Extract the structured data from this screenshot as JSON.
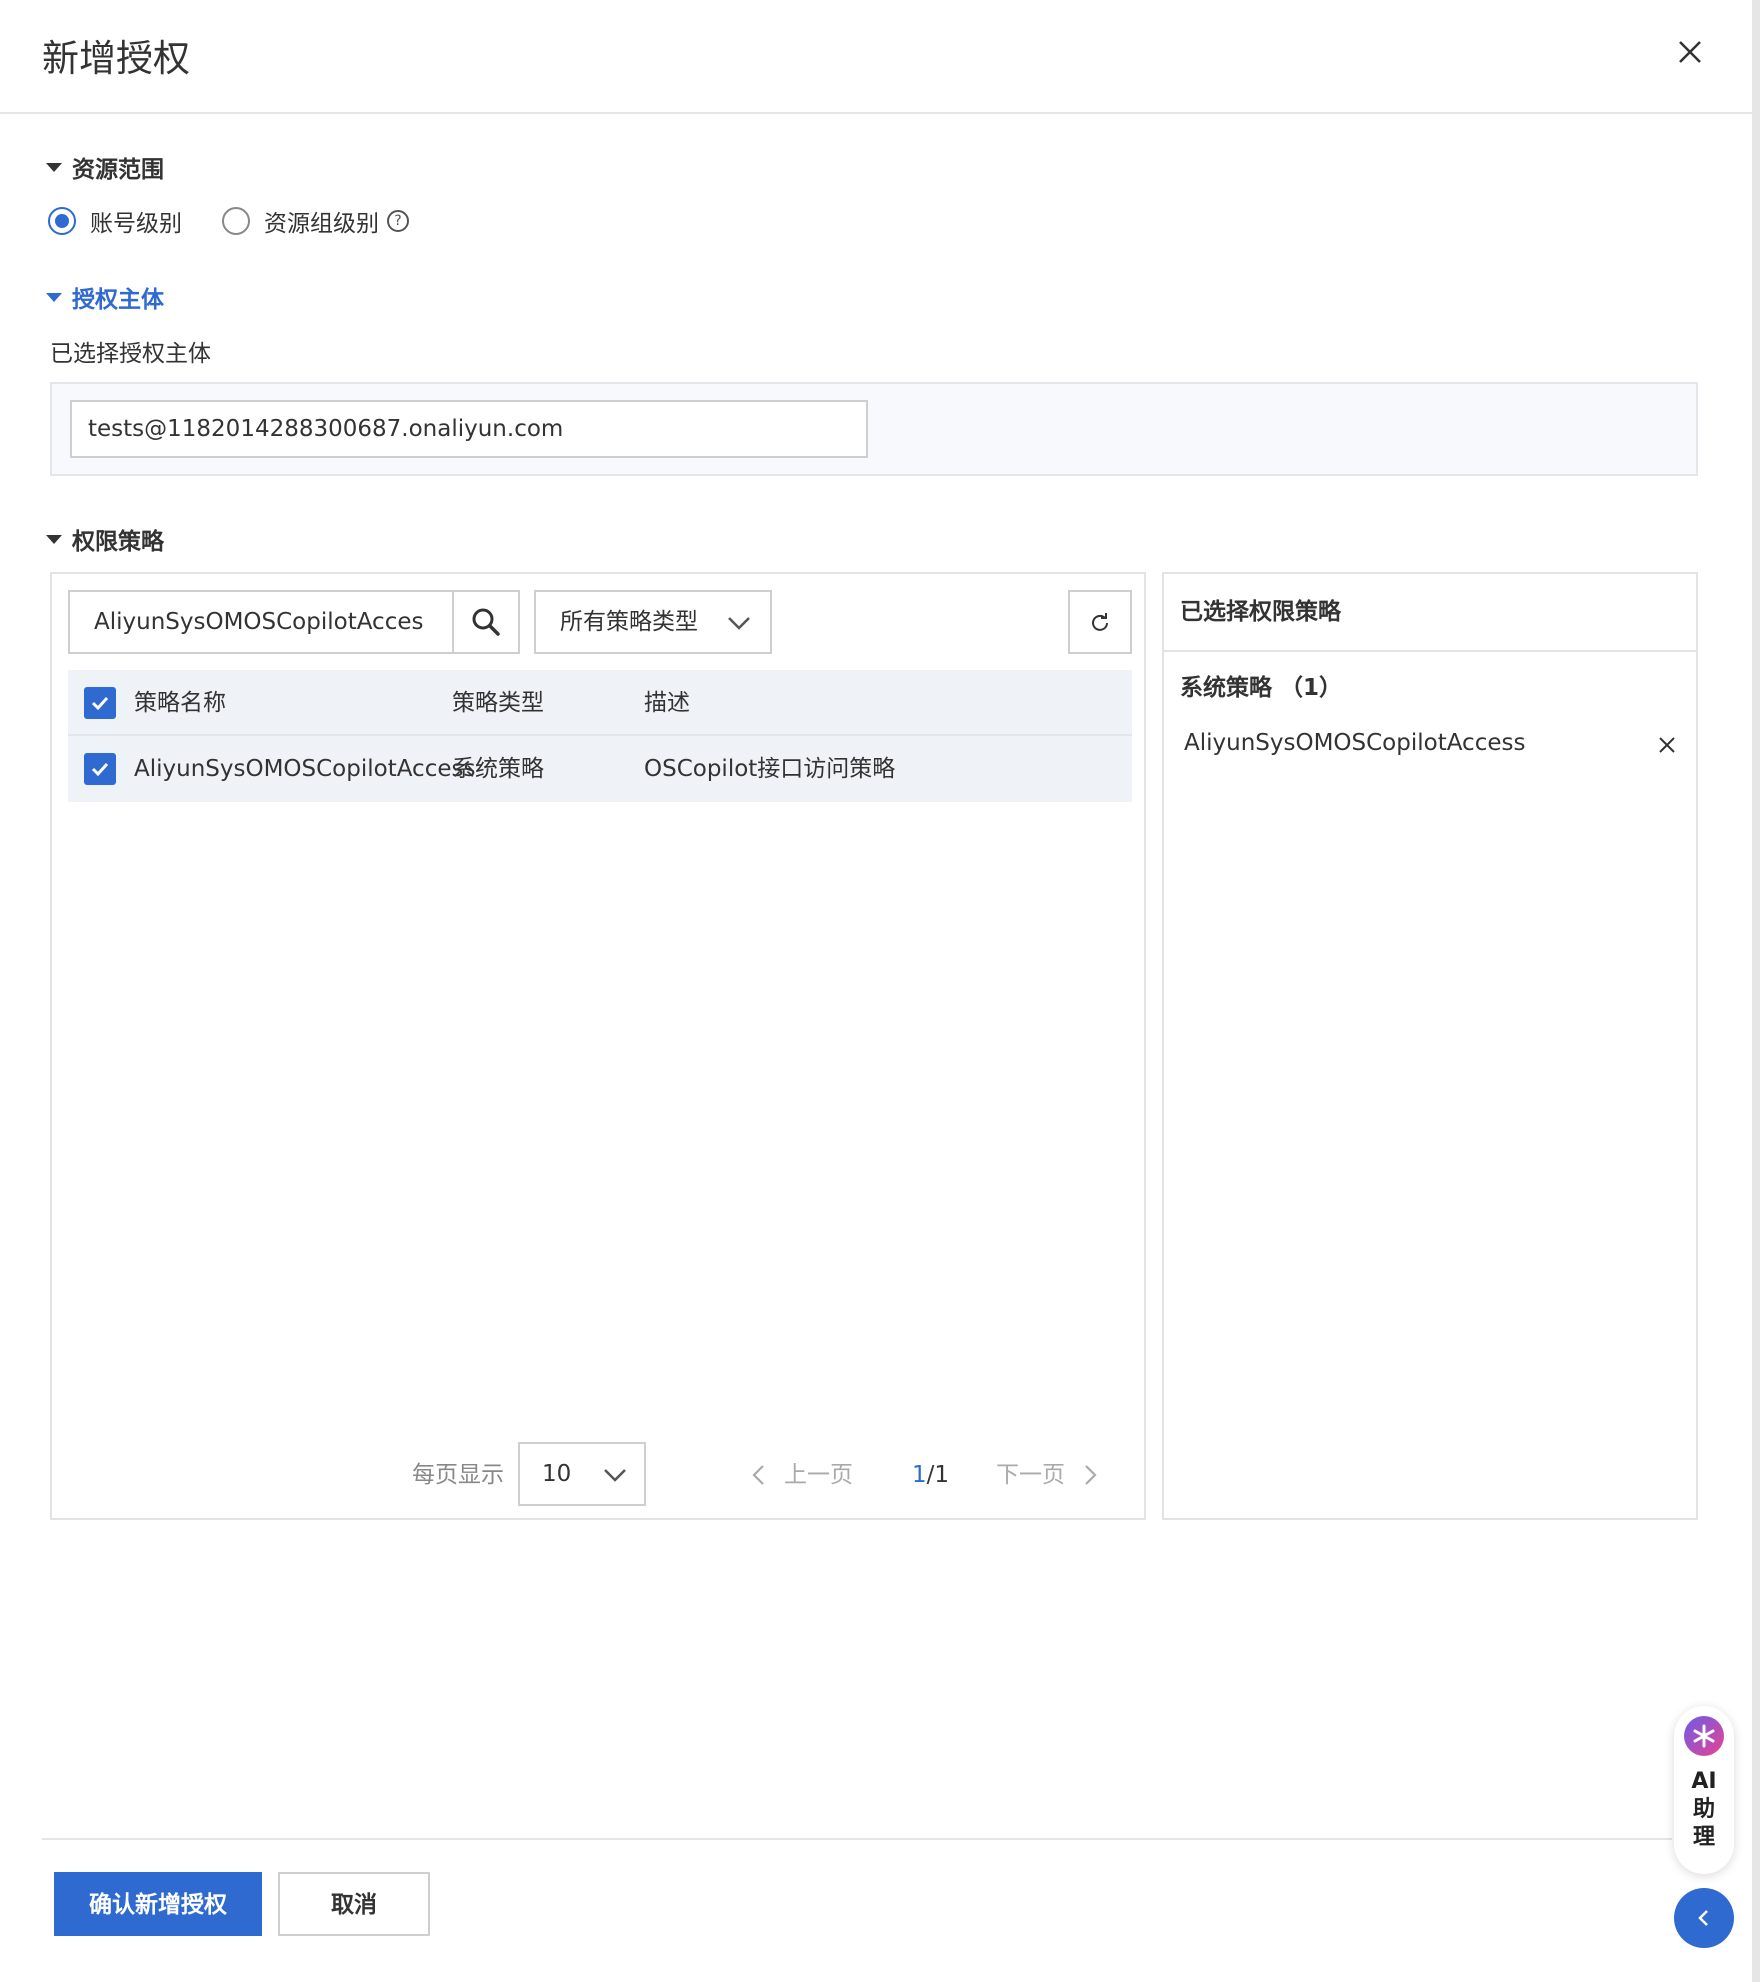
{
  "dialog": {
    "title": "新增授权"
  },
  "resource_scope": {
    "heading": "资源范围",
    "options": [
      {
        "label": "账号级别",
        "checked": true
      },
      {
        "label": "资源组级别",
        "checked": false
      }
    ],
    "help_glyph": "?"
  },
  "principal": {
    "heading": "授权主体",
    "sub_label": "已选择授权主体",
    "value": "tests@1182014288300687.onaliyun.com"
  },
  "policies": {
    "heading": "权限策略",
    "search_value": "AliyunSysOMOSCopilotAcces",
    "type_filter": "所有策略类型",
    "columns": [
      "策略名称",
      "策略类型",
      "描述"
    ],
    "rows": [
      {
        "name": "AliyunSysOMOSCopilotAccess",
        "type": "系统策略",
        "desc": "OSCopilot接口访问策略",
        "checked": true
      }
    ],
    "pager": {
      "per_page_label": "每页显示",
      "page_size": "10",
      "prev_label": "上一页",
      "current": "1",
      "total": "/1",
      "next_label": "下一页"
    }
  },
  "selected_policies": {
    "title": "已选择权限策略",
    "group_label": "系统策略 （1）",
    "items": [
      "AliyunSysOMOSCopilotAccess"
    ]
  },
  "footer": {
    "confirm_label": "确认新增授权",
    "cancel_label": "取消"
  },
  "ai_assistant": {
    "label_lines": [
      "AI",
      "助",
      "理"
    ]
  },
  "colors": {
    "accent": "#2f6ad1",
    "border": "#cfcfcf",
    "table_header_bg": "#eff3f8"
  }
}
